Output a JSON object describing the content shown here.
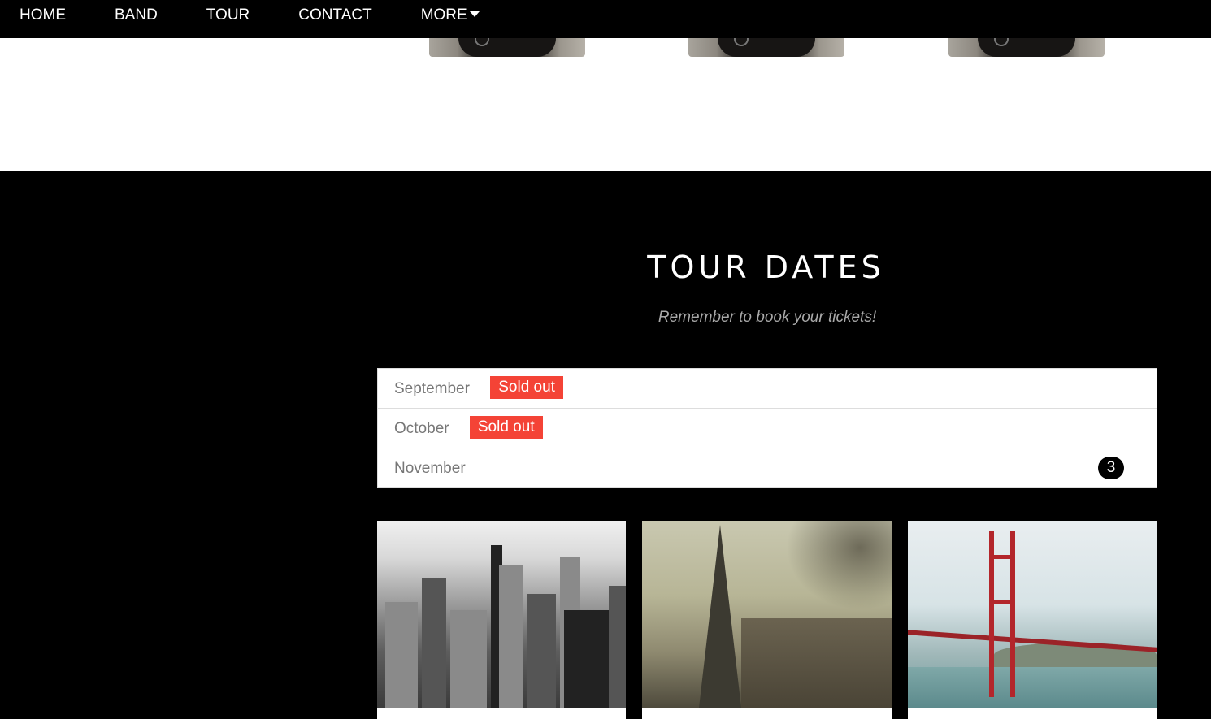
{
  "nav": {
    "items": [
      "HOME",
      "BAND",
      "TOUR",
      "CONTACT"
    ],
    "more_label": "MORE"
  },
  "tour": {
    "title": "TOUR DATES",
    "subtitle": "Remember to book your tickets!",
    "months": [
      {
        "name": "September",
        "badge": "Sold out"
      },
      {
        "name": "October",
        "badge": "Sold out"
      },
      {
        "name": "November",
        "count": "3"
      }
    ]
  },
  "colors": {
    "soldout": "#f44336",
    "background": "#000000",
    "text_muted": "#777777"
  }
}
